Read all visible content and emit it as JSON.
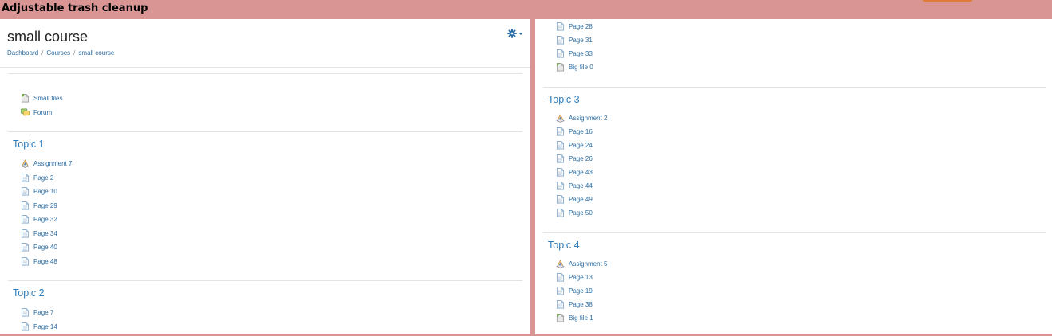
{
  "banner": {
    "title": "Adjustable trash cleanup"
  },
  "course": {
    "title": "small course"
  },
  "breadcrumb": [
    "Dashboard",
    "Courses",
    "small course"
  ],
  "left": {
    "general_items": [
      {
        "label": "Small files",
        "icon": "file-icon"
      },
      {
        "label": "Forum",
        "icon": "forum-icon"
      }
    ],
    "topic1": {
      "title": "Topic 1",
      "items": [
        {
          "label": "Assignment 7",
          "icon": "assignment-icon"
        },
        {
          "label": "Page 2",
          "icon": "page-icon"
        },
        {
          "label": "Page 10",
          "icon": "page-icon"
        },
        {
          "label": "Page 29",
          "icon": "page-icon"
        },
        {
          "label": "Page 32",
          "icon": "page-icon"
        },
        {
          "label": "Page 34",
          "icon": "page-icon"
        },
        {
          "label": "Page 40",
          "icon": "page-icon"
        },
        {
          "label": "Page 48",
          "icon": "page-icon"
        }
      ]
    },
    "topic2": {
      "title": "Topic 2",
      "items": [
        {
          "label": "Page 7",
          "icon": "page-icon"
        },
        {
          "label": "Page 14",
          "icon": "page-icon"
        }
      ]
    }
  },
  "right": {
    "top_items": [
      {
        "label": "Page 28",
        "icon": "page-icon"
      },
      {
        "label": "Page 31",
        "icon": "page-icon"
      },
      {
        "label": "Page 33",
        "icon": "page-icon"
      },
      {
        "label": "Big file 0",
        "icon": "file-icon"
      }
    ],
    "topic3": {
      "title": "Topic 3",
      "items": [
        {
          "label": "Assignment 2",
          "icon": "assignment-icon"
        },
        {
          "label": "Page 16",
          "icon": "page-icon"
        },
        {
          "label": "Page 24",
          "icon": "page-icon"
        },
        {
          "label": "Page 26",
          "icon": "page-icon"
        },
        {
          "label": "Page 43",
          "icon": "page-icon"
        },
        {
          "label": "Page 44",
          "icon": "page-icon"
        },
        {
          "label": "Page 49",
          "icon": "page-icon"
        },
        {
          "label": "Page 50",
          "icon": "page-icon"
        }
      ]
    },
    "topic4": {
      "title": "Topic 4",
      "items": [
        {
          "label": "Assignment 5",
          "icon": "assignment-icon"
        },
        {
          "label": "Page 13",
          "icon": "page-icon"
        },
        {
          "label": "Page 19",
          "icon": "page-icon"
        },
        {
          "label": "Page 38",
          "icon": "page-icon"
        },
        {
          "label": "Big file 1",
          "icon": "file-icon"
        }
      ]
    }
  }
}
